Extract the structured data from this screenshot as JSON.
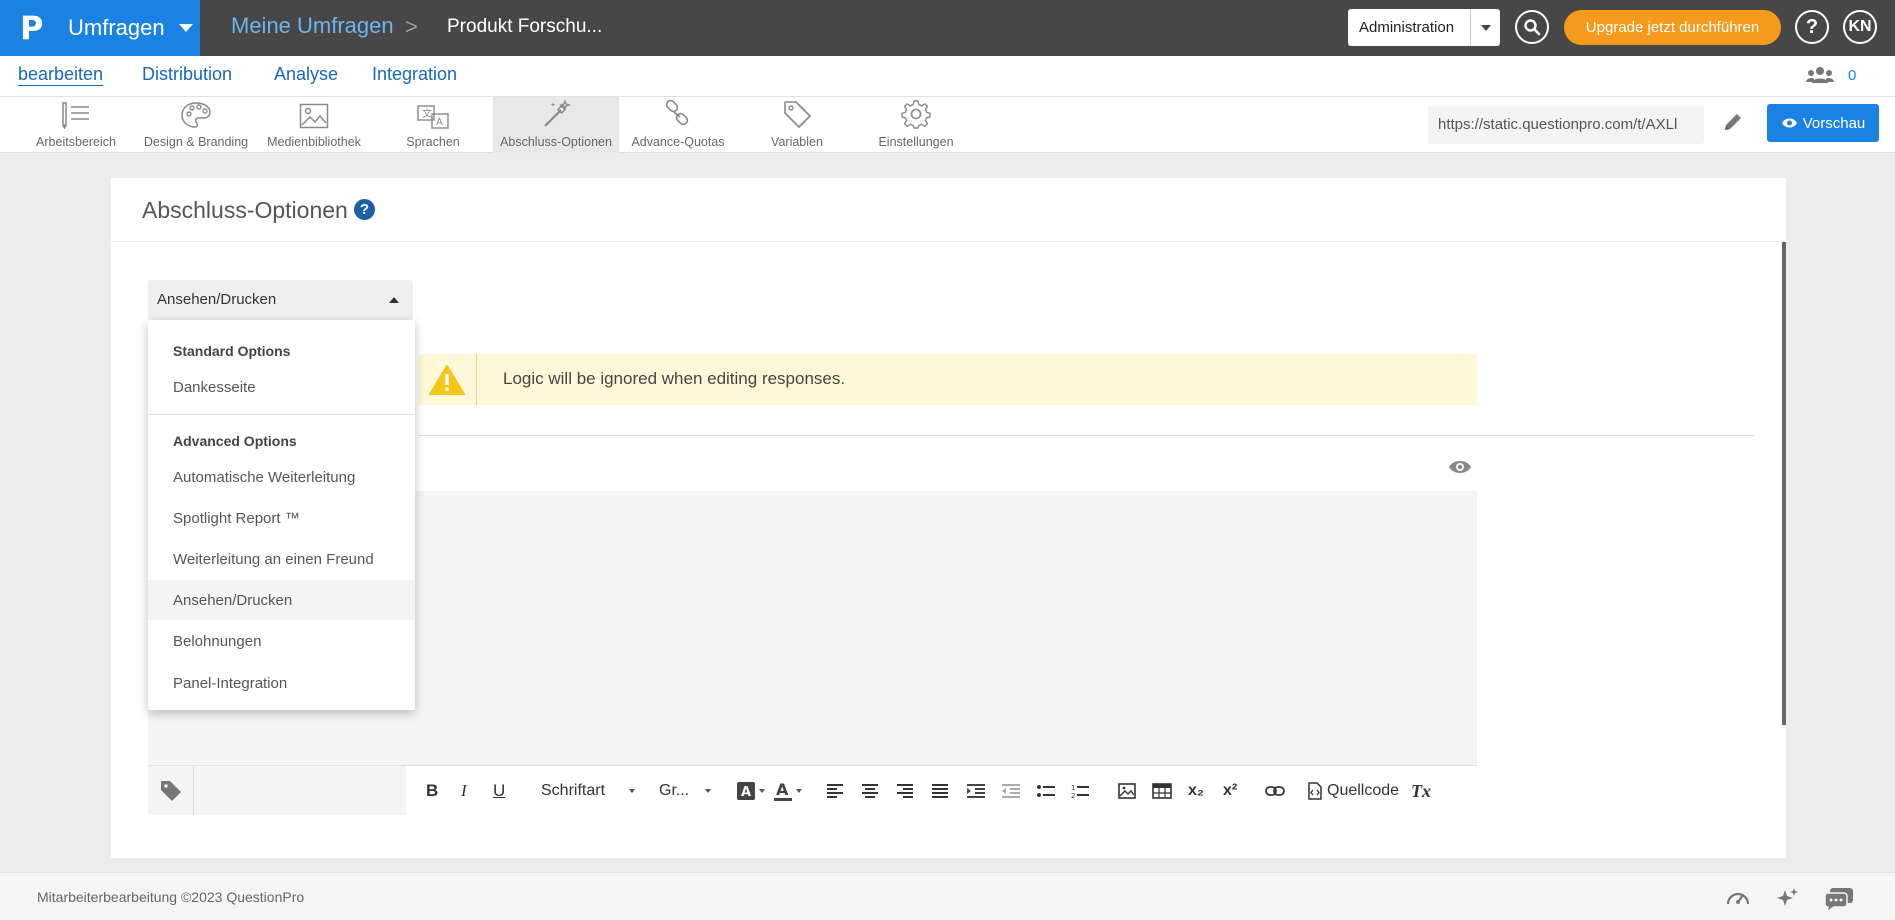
{
  "header": {
    "brand": "Umfragen",
    "crumb_home": "Meine Umfragen",
    "crumb_sep": ">",
    "crumb_current": "Produkt Forschu...",
    "admin": "Administration",
    "upgrade": "Upgrade jetzt durchführen",
    "help": "?",
    "avatar": "KN",
    "accent": "#1a82e2",
    "upgrade_color": "#f79a1b"
  },
  "tabs": [
    {
      "label": "bearbeiten",
      "active": true
    },
    {
      "label": "Distribution"
    },
    {
      "label": "Analyse"
    },
    {
      "label": "Integration"
    }
  ],
  "collaborators": {
    "count": "0"
  },
  "toolbar": {
    "items": [
      {
        "label": "Arbeitsbereich",
        "icon": "workspace-icon"
      },
      {
        "label": "Design & Branding",
        "icon": "palette-icon"
      },
      {
        "label": "Medienbibliothek",
        "icon": "image-icon"
      },
      {
        "label": "Sprachen",
        "icon": "translate-icon"
      },
      {
        "label": "Abschluss-Optionen",
        "icon": "magic-wand-icon",
        "active": true
      },
      {
        "label": "Advance-Quotas",
        "icon": "quota-icon"
      },
      {
        "label": "Variablen",
        "icon": "tag-icon"
      },
      {
        "label": "Einstellungen",
        "icon": "gear-icon"
      }
    ],
    "url": "https://static.questionpro.com/t/AXLl",
    "preview": "Vorschau"
  },
  "panel": {
    "title": "Abschluss-Optionen",
    "select_value": "Ansehen/Drucken",
    "warning": "Logic will be ignored when editing responses."
  },
  "menu": {
    "group_standard": "Standard Options",
    "standard_items": [
      "Dankesseite"
    ],
    "group_advanced": "Advanced Options",
    "advanced_items": [
      "Automatische Weiterleitung",
      "Spotlight Report ™",
      "Weiterleitung an einen Freund",
      "Ansehen/Drucken",
      "Belohnungen",
      "Panel-Integration"
    ],
    "selected": "Ansehen/Drucken"
  },
  "editor": {
    "bold": "B",
    "italic": "I",
    "underline": "U",
    "font": "Schriftart",
    "size": "Gr...",
    "subscript": "x₂",
    "superscript": "x²",
    "source": "Quellcode",
    "clear": "Tx"
  },
  "footer": {
    "text": "Mitarbeiterbearbeitung ©2023 QuestionPro"
  }
}
